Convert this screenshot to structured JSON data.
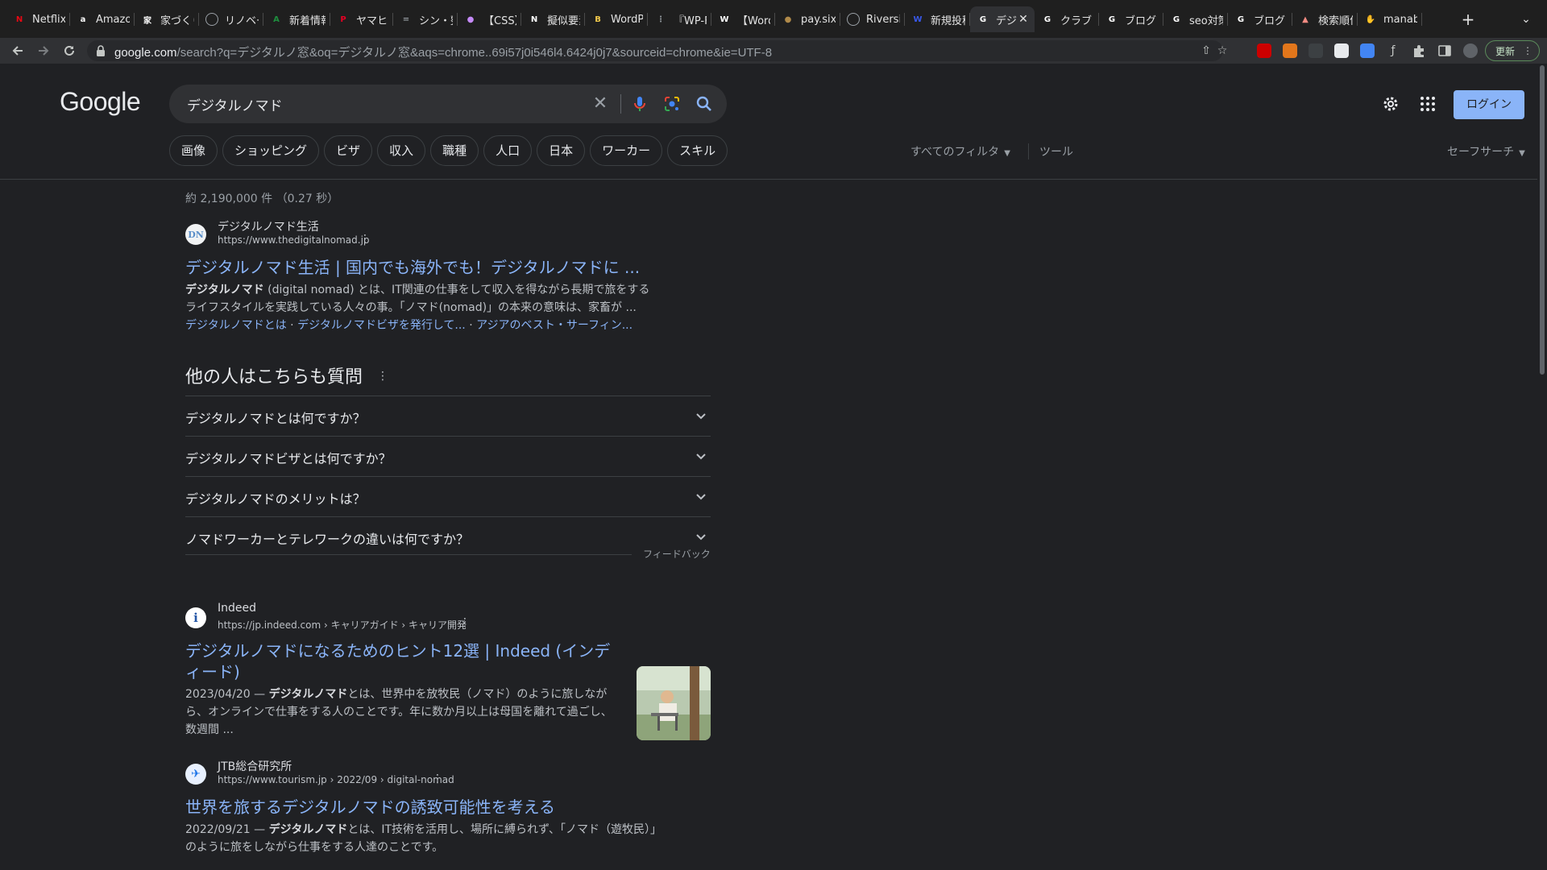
{
  "tabs": [
    {
      "title": "Netflix",
      "icon": "netflix-icon",
      "color": "#e50914",
      "glyph": "N"
    },
    {
      "title": "Amazon",
      "icon": "amazon-icon",
      "color": "#ffffff",
      "glyph": "a"
    },
    {
      "title": "家づくり",
      "icon": "house-icon",
      "color": "#ffffff",
      "glyph": "家"
    },
    {
      "title": "リノベー",
      "icon": "globe-icon",
      "color": "#9aa0a6",
      "glyph": ""
    },
    {
      "title": "新着情報",
      "icon": "leaf-icon",
      "color": "#1e8e3e",
      "glyph": "A"
    },
    {
      "title": "ヤマヒロ",
      "icon": "pinterest-icon",
      "color": "#e60023",
      "glyph": "P"
    },
    {
      "title": "シン・整",
      "icon": "menu-icon",
      "color": "#9aa0a6",
      "glyph": "="
    },
    {
      "title": "【CSS】",
      "icon": "cat-icon",
      "color": "#c58af9",
      "glyph": "●"
    },
    {
      "title": "擬似要素",
      "icon": "notion-icon",
      "color": "#ffffff",
      "glyph": "N"
    },
    {
      "title": "WordPr",
      "icon": "bootstrap-icon",
      "color": "#f2c94c",
      "glyph": "B"
    },
    {
      "title": "『WP-F",
      "icon": "dots-icon",
      "color": "#9aa0a6",
      "glyph": "⋮"
    },
    {
      "title": "【Word",
      "icon": "wikipedia-icon",
      "color": "#ffffff",
      "glyph": "W"
    },
    {
      "title": "pay.six",
      "icon": "coin-icon",
      "color": "#b08a4a",
      "glyph": "●"
    },
    {
      "title": "Riversi",
      "icon": "globe-icon",
      "color": "#9aa0a6",
      "glyph": ""
    },
    {
      "title": "新規投稿",
      "icon": "wordpress-icon",
      "color": "#3858e9",
      "glyph": "W"
    },
    {
      "title": "デジ",
      "icon": "google-icon",
      "color": "#ffffff",
      "glyph": "G",
      "active": true
    },
    {
      "title": "クラブ",
      "icon": "google-icon",
      "color": "#ffffff",
      "glyph": "G"
    },
    {
      "title": "ブログ",
      "icon": "google-icon",
      "color": "#ffffff",
      "glyph": "G"
    },
    {
      "title": "seo対策",
      "icon": "google-icon",
      "color": "#ffffff",
      "glyph": "G"
    },
    {
      "title": "ブログ",
      "icon": "google-icon",
      "color": "#ffffff",
      "glyph": "G"
    },
    {
      "title": "検索順位",
      "icon": "chart-icon",
      "color": "#f28b82",
      "glyph": "▲"
    },
    {
      "title": "manab",
      "icon": "hand-icon",
      "color": "#8ab4f8",
      "glyph": "✋"
    }
  ],
  "address_bar": {
    "host": "google.com",
    "path": "/search?q=デジタルノ窓&oq=デジタルノ窓&aqs=chrome..69i57j0i546l4.6424j0j7&sourceid=chrome&ie=UTF-8"
  },
  "update_button": "更新",
  "logo": "Google",
  "search": {
    "query": "デジタルノマド"
  },
  "login_button": "ログイン",
  "chips": [
    "画像",
    "ショッピング",
    "ビザ",
    "収入",
    "職種",
    "人口",
    "日本",
    "ワーカー",
    "スキル"
  ],
  "filters": {
    "all_filters": "すべてのフィルタ",
    "tools": "ツール",
    "safesearch": "セーフサーチ"
  },
  "result_stats": "約 2,190,000 件 （0.27 秒）",
  "results": [
    {
      "site_name": "デジタルノマド生活",
      "url": "https://www.thedigitalnomad.jp",
      "favicon_text": "DN",
      "title": "デジタルノマド生活 | 国内でも海外でも！デジタルノマドに ...",
      "snippet_bold": "デジタルノマド",
      "snippet": " (digital nomad) とは、IT関連の仕事をして収入を得ながら長期で旅をするライフスタイルを実践している人々の事。「ノマド(nomad)」の本来の意味は、家畜が ...",
      "sitelinks": [
        "デジタルノマドとは",
        "デジタルノマドビザを発行して...",
        "アジアのベスト・サーフィン..."
      ]
    },
    {
      "site_name": "Indeed",
      "url": "https://jp.indeed.com › キャリアガイド › キャリア開発",
      "favicon_text": "i",
      "title": "デジタルノマドになるためのヒント12選 | Indeed (インディード)",
      "snippet_date": "2023/04/20 — ",
      "snippet_bold": "デジタルノマド",
      "snippet": "とは、世界中を放牧民（ノマド）のように旅しながら、オンラインで仕事をする人のことです。年に数か月以上は母国を離れて過ごし、数週間 ..."
    },
    {
      "site_name": "JTB総合研究所",
      "url": "https://www.tourism.jp › 2022/09 › digital-nomad",
      "favicon_text": "✈",
      "title": "世界を旅するデジタルノマドの誘致可能性を考える",
      "snippet_date": "2022/09/21 — ",
      "snippet_bold": "デジタルノマド",
      "snippet": "とは、IT技術を活用し、場所に縛られず、「ノマド（遊牧民）」のように旅をしながら仕事をする人達のことです。"
    }
  ],
  "paa": {
    "title": "他の人はこちらも質問",
    "questions": [
      "デジタルノマドとは何ですか？",
      "デジタルノマドビザとは何ですか？",
      "デジタルノマドのメリットは？",
      "ノマドワーカーとテレワークの違いは何ですか？"
    ],
    "feedback": "フィードバック"
  },
  "colors": {
    "link": "#8ab4f8",
    "background": "#202124",
    "accent": "#8ab4f8"
  }
}
